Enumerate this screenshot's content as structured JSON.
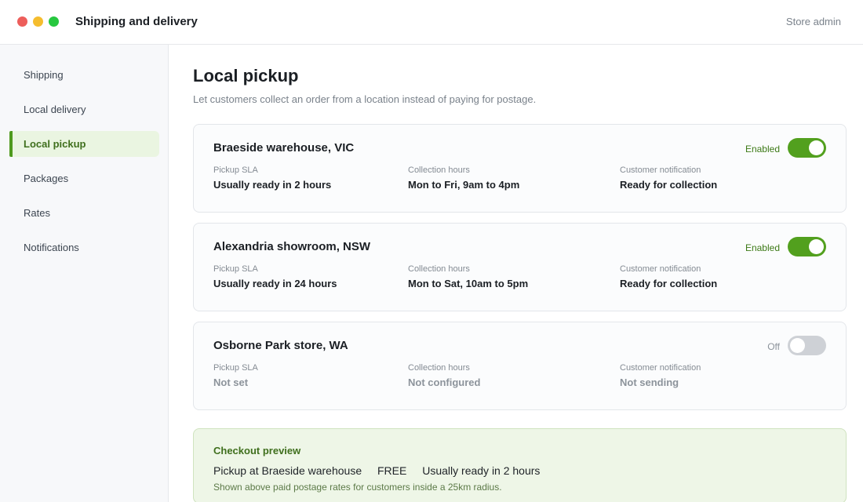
{
  "window": {
    "title": "Shipping and delivery",
    "user_menu": "Store admin"
  },
  "sidebar": {
    "items": [
      {
        "label": "Shipping",
        "active": false
      },
      {
        "label": "Local delivery",
        "active": false
      },
      {
        "label": "Local pickup",
        "active": true
      },
      {
        "label": "Packages",
        "active": false
      },
      {
        "label": "Rates",
        "active": false
      },
      {
        "label": "Notifications",
        "active": false
      }
    ]
  },
  "main": {
    "title": "Local pickup",
    "subtitle": "Let customers collect an order from a location instead of paying for postage."
  },
  "locations": [
    {
      "name": "Braeside warehouse, VIC",
      "status": "Enabled",
      "enabled": true,
      "fields": [
        {
          "label": "Pickup SLA",
          "value": "Usually ready in 2 hours"
        },
        {
          "label": "Collection hours",
          "value": "Mon to Fri, 9am to 4pm"
        },
        {
          "label": "Customer notification",
          "value": "Ready for collection"
        }
      ]
    },
    {
      "name": "Alexandria showroom, NSW",
      "status": "Enabled",
      "enabled": true,
      "fields": [
        {
          "label": "Pickup SLA",
          "value": "Usually ready in 24 hours"
        },
        {
          "label": "Collection hours",
          "value": "Mon to Sat, 10am to 5pm"
        },
        {
          "label": "Customer notification",
          "value": "Ready for collection"
        }
      ]
    },
    {
      "name": "Osborne Park store, WA",
      "status": "Off",
      "enabled": false,
      "fields": [
        {
          "label": "Pickup SLA",
          "value": "Not set"
        },
        {
          "label": "Collection hours",
          "value": "Not configured"
        },
        {
          "label": "Customer notification",
          "value": "Not sending"
        }
      ]
    }
  ],
  "checkout_preview": {
    "title": "Checkout preview",
    "option_name": "Pickup at Braeside warehouse",
    "price": "FREE",
    "sla": "Usually ready in 2 hours",
    "note": "Shown above paid postage rates for customers inside a 25km radius."
  },
  "colors": {
    "accent": "#52a01e",
    "accent_text": "#3f6f1d",
    "toggle_off": "#ced1d6"
  }
}
